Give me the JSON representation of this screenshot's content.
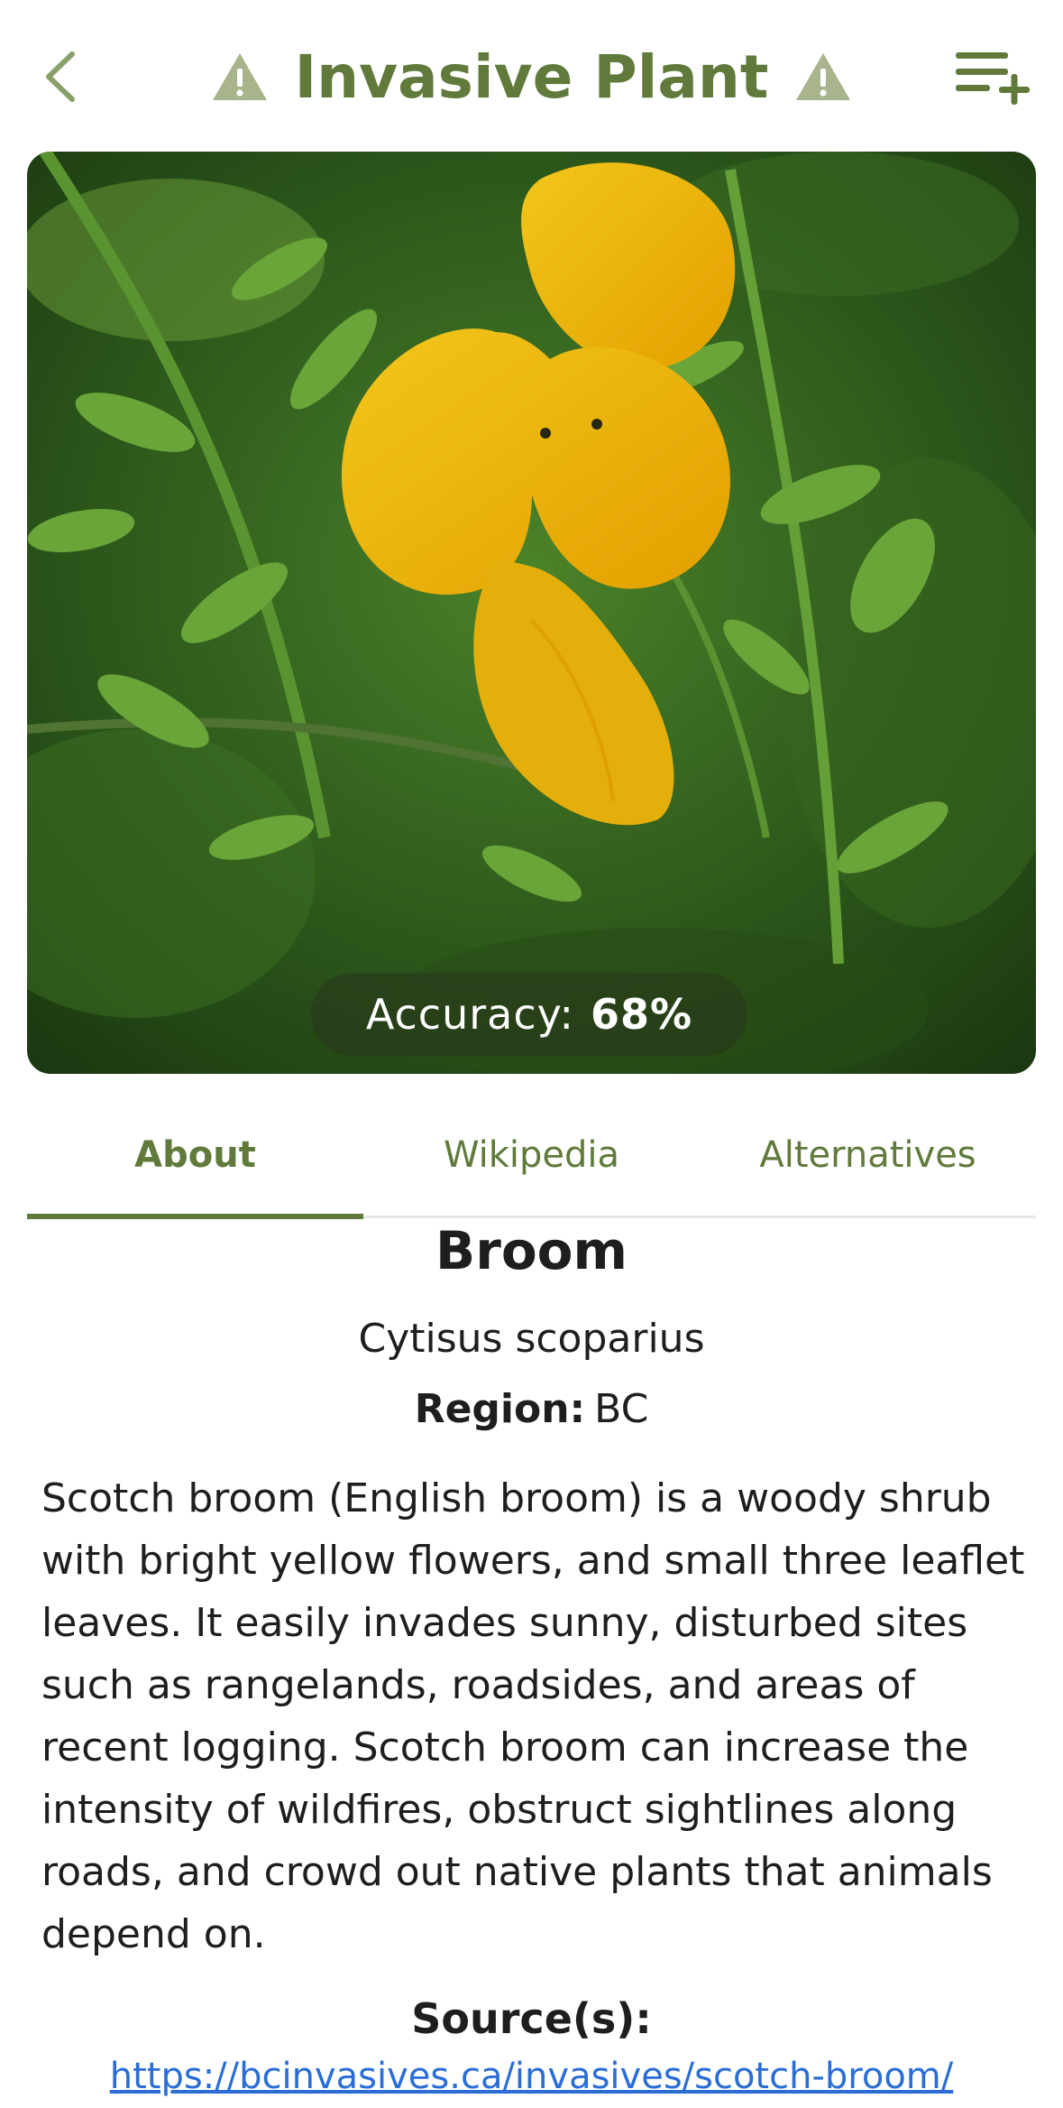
{
  "header": {
    "title": "Invasive Plant",
    "back_icon": "chevron-left-icon",
    "warning_icon": "warning-triangle-icon",
    "add_list_icon": "playlist-add-icon"
  },
  "photo": {
    "accuracy_label": "Accuracy:",
    "accuracy_value": "68%"
  },
  "tabs": [
    {
      "label": "About",
      "active": true
    },
    {
      "label": "Wikipedia",
      "active": false
    },
    {
      "label": "Alternatives",
      "active": false
    }
  ],
  "plant": {
    "common_name": "Broom",
    "scientific_name": "Cytisus scoparius",
    "region_label": "Region:",
    "region_value": "BC",
    "description": "Scotch broom (English broom) is a woody shrub with bright yellow flowers, and small three leaflet leaves. It easily invades sunny, disturbed sites such as rangelands, roadsides, and areas of recent logging. Scotch broom can increase the intensity of wildfires, obstruct sightlines along roads, and crowd out native plants that animals depend on.",
    "source_label": "Source(s):",
    "source_url": "https://bcinvasives.ca/invasives/scotch-broom/"
  },
  "colors": {
    "accent": "#5f7a3a",
    "link": "#2a6dd6",
    "text": "#1e1e1e"
  }
}
